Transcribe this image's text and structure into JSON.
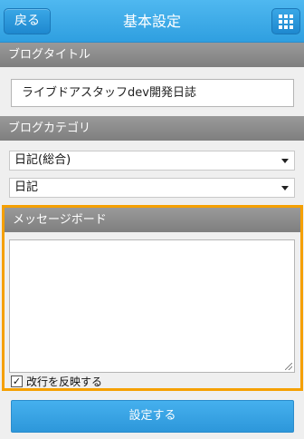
{
  "header": {
    "back_label": "戻る",
    "title": "基本設定",
    "menu_icon": "grid-icon"
  },
  "blog_title": {
    "section_label": "ブログタイトル",
    "value": "ライブドアスタッフdev開発日誌"
  },
  "blog_category": {
    "section_label": "ブログカテゴリ",
    "primary_selected": "日記(総合)",
    "secondary_selected": "日記"
  },
  "message_board": {
    "section_label": "メッセージボード",
    "value": "",
    "linebreak_checkbox_label": "改行を反映する",
    "linebreak_checked": true
  },
  "submit_label": "設定する",
  "colors": {
    "header": "#2f9fe0",
    "section_bar": "#8a8a8a",
    "highlight": "#f5a000",
    "submit": "#3aa3e4"
  }
}
